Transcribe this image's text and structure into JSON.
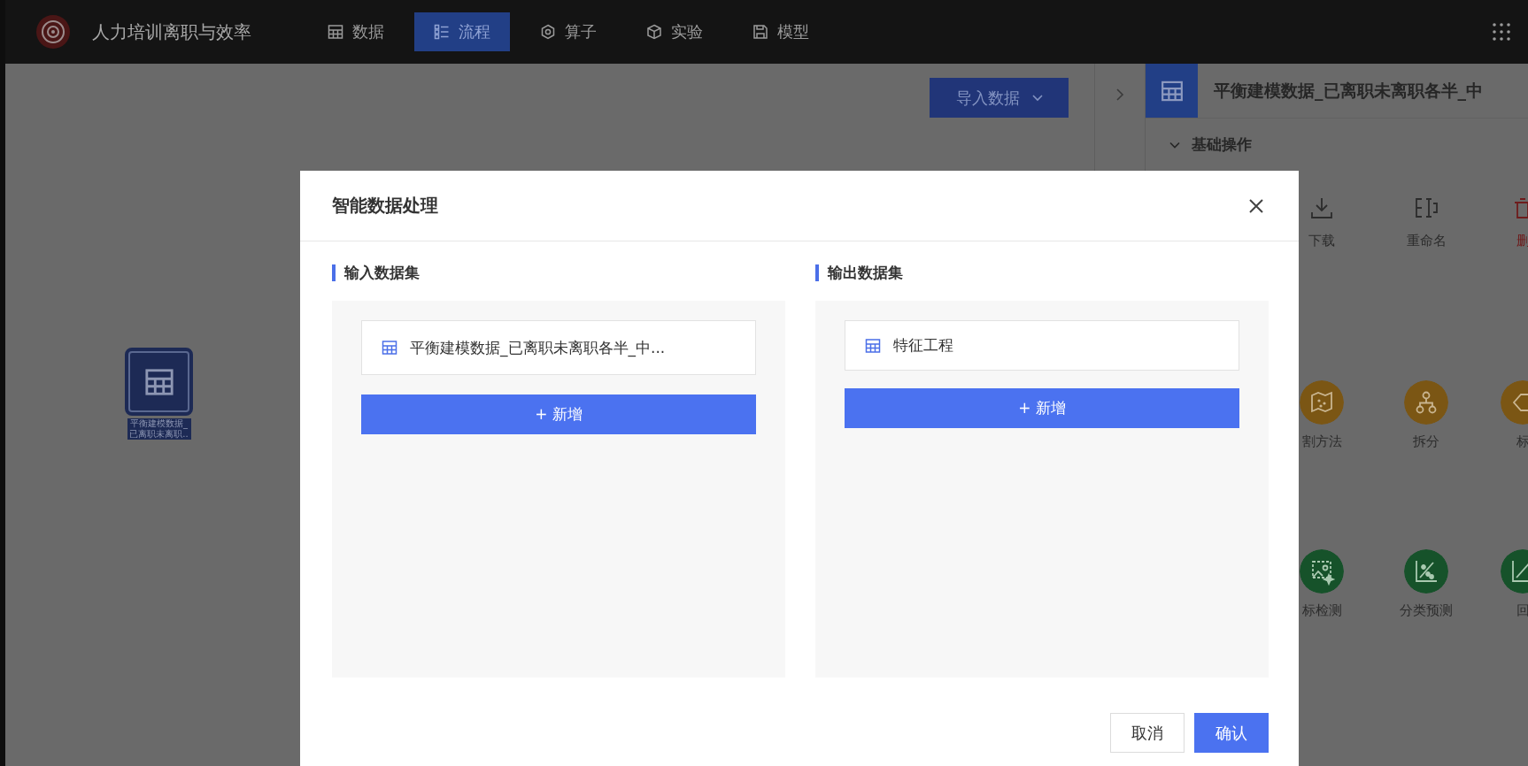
{
  "app": {
    "title": "人力培训离职与效率",
    "nav": [
      {
        "label": "数据",
        "kind": "table",
        "selected": false
      },
      {
        "label": "流程",
        "kind": "flow",
        "selected": true
      },
      {
        "label": "算子",
        "kind": "operator",
        "selected": false
      },
      {
        "label": "实验",
        "kind": "cube",
        "selected": false
      },
      {
        "label": "模型",
        "kind": "save",
        "selected": false
      }
    ]
  },
  "canvas": {
    "import_button": "导入数据",
    "nodes": [
      {
        "label": "平衡建模数据_已离职未离职.."
      }
    ]
  },
  "right_panel": {
    "title": "平衡建模数据_已离职未离职各半_中",
    "section": {
      "title": "基础操作",
      "expanded": true
    },
    "actions": [
      {
        "label": "下载",
        "kind": "download"
      },
      {
        "label": "重命名",
        "kind": "rename"
      },
      {
        "label": "删",
        "kind": "delete"
      }
    ],
    "operators": [
      {
        "label": "割方法",
        "kind": "map",
        "color": "#7b5614"
      },
      {
        "label": "拆分",
        "kind": "split",
        "color": "#7b5614"
      },
      {
        "label": "标",
        "kind": "tag",
        "color": "#7b5614"
      },
      {
        "label": "标检测",
        "kind": "detect",
        "color": "#16522a"
      },
      {
        "label": "分类预测",
        "kind": "classify",
        "color": "#16522a"
      },
      {
        "label": "回",
        "kind": "regress",
        "color": "#16522a"
      }
    ]
  },
  "dialog": {
    "title": "智能数据处理",
    "input": {
      "title": "输入数据集",
      "items": [
        "平衡建模数据_已离职未离职各半_中..."
      ],
      "add_button": "+ 新增"
    },
    "output": {
      "title": "输出数据集",
      "items": [
        "特征工程"
      ],
      "add_button": "+ 新增"
    },
    "buttons": [
      {
        "label": "取消",
        "kind": "secondary"
      },
      {
        "label": "确认",
        "kind": "primary"
      }
    ]
  }
}
